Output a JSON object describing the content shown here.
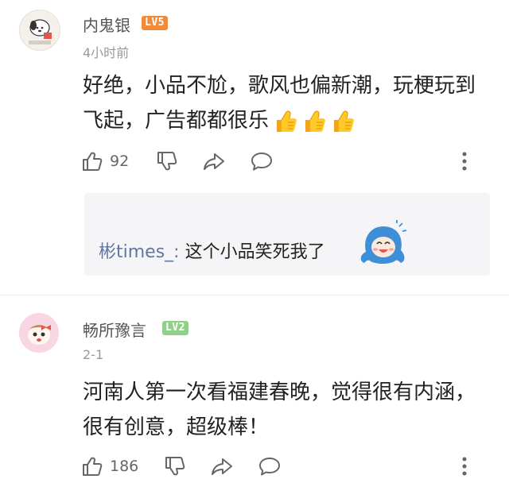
{
  "comments": [
    {
      "username": "内鬼银",
      "level": "LV5",
      "level_color": "#f28a37",
      "time": "4小时前",
      "text_line1": "好绝，小品不尬，歌风也偏新潮，玩梗玩到",
      "text_line2": "飞起，广告都都很乐",
      "emoji": [
        "thumbs-up-emoji",
        "thumbs-up-emoji",
        "thumbs-up-emoji"
      ],
      "likes": "92",
      "reply": {
        "username": "彬times_",
        "separator": ":",
        "text": "这个小品笑死我了",
        "sticker": "laughing-character-sticker"
      }
    },
    {
      "username": "畅所豫言",
      "level": "LV2",
      "level_color": "#8fd18a",
      "time": "2-1",
      "text_line1": "河南人第一次看福建春晚，觉得很有内涵，",
      "text_line2": "很有创意，超级棒！",
      "likes": "186"
    }
  ],
  "icons": {
    "like": "thumb-up-outline-icon",
    "dislike": "thumb-down-outline-icon",
    "share": "share-arrow-icon",
    "reply": "comment-bubble-icon",
    "more": "more-vertical-icon"
  }
}
